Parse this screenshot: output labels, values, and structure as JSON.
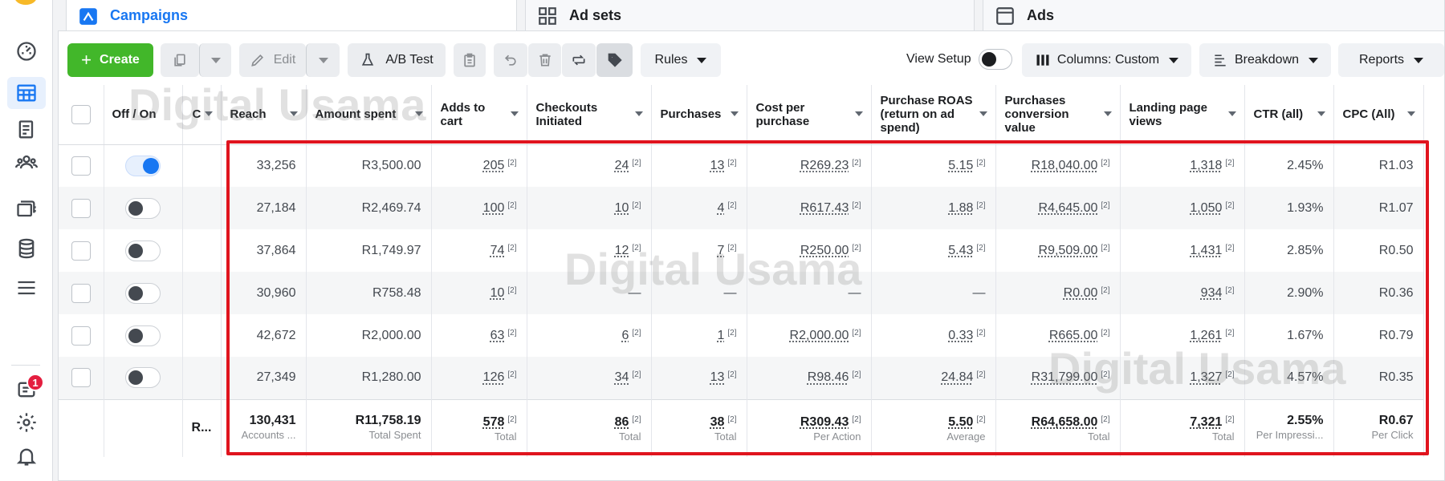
{
  "tabs": {
    "campaigns": "Campaigns",
    "adsets": "Ad sets",
    "ads": "Ads"
  },
  "toolbar": {
    "create": "Create",
    "edit": "Edit",
    "ab_test": "A/B Test",
    "rules": "Rules",
    "view_setup": "View Setup",
    "columns": "Columns: Custom",
    "breakdown": "Breakdown",
    "reports": "Reports"
  },
  "rail": {
    "notification_count": "1"
  },
  "table": {
    "headers": {
      "off_on": "Off / On",
      "name_truncated": "C",
      "reach": "Reach",
      "amount_spent": "Amount spent",
      "adds_to_cart": "Adds to cart",
      "checkouts": "Checkouts Initiated",
      "purchases": "Purchases",
      "cost_per_purchase": "Cost per purchase",
      "roas": "Purchase ROAS (return on ad spend)",
      "conv_value": "Purchases conversion value",
      "lpv": "Landing page views",
      "ctr": "CTR (all)",
      "cpc": "CPC (All)"
    },
    "rows": [
      {
        "on": true,
        "reach": "33,256",
        "spent": "R3,500.00",
        "atc": "205",
        "chk": "24",
        "pur": "13",
        "cpp": "R269.23",
        "roas": "5.15",
        "val": "R18,040.00",
        "lpv": "1,318",
        "ctr": "2.45%",
        "cpc": "R1.03"
      },
      {
        "on": false,
        "reach": "27,184",
        "spent": "R2,469.74",
        "atc": "100",
        "chk": "10",
        "pur": "4",
        "cpp": "R617.43",
        "roas": "1.88",
        "val": "R4,645.00",
        "lpv": "1,050",
        "ctr": "1.93%",
        "cpc": "R1.07"
      },
      {
        "on": false,
        "reach": "37,864",
        "spent": "R1,749.97",
        "atc": "74",
        "chk": "12",
        "pur": "7",
        "cpp": "R250.00",
        "roas": "5.43",
        "val": "R9,509.00",
        "lpv": "1,431",
        "ctr": "2.85%",
        "cpc": "R0.50"
      },
      {
        "on": false,
        "reach": "30,960",
        "spent": "R758.48",
        "atc": "10",
        "chk": "—",
        "pur": "—",
        "cpp": "—",
        "roas": "—",
        "val": "R0.00",
        "lpv": "934",
        "ctr": "2.90%",
        "cpc": "R0.36"
      },
      {
        "on": false,
        "reach": "42,672",
        "spent": "R2,000.00",
        "atc": "63",
        "chk": "6",
        "pur": "1",
        "cpp": "R2,000.00",
        "roas": "0.33",
        "val": "R665.00",
        "lpv": "1,261",
        "ctr": "1.67%",
        "cpc": "R0.79"
      },
      {
        "on": false,
        "reach": "27,349",
        "spent": "R1,280.00",
        "atc": "126",
        "chk": "34",
        "pur": "13",
        "cpp": "R98.46",
        "roas": "24.84",
        "val": "R31,799.00",
        "lpv": "1,327",
        "ctr": "4.57%",
        "cpc": "R0.35"
      }
    ],
    "footnote_mark": "[2]",
    "totals": {
      "name": "R...",
      "reach": {
        "v": "130,431",
        "l": "Accounts ..."
      },
      "spent": {
        "v": "R11,758.19",
        "l": "Total Spent"
      },
      "atc": {
        "v": "578",
        "l": "Total"
      },
      "chk": {
        "v": "86",
        "l": "Total"
      },
      "pur": {
        "v": "38",
        "l": "Total"
      },
      "cpp": {
        "v": "R309.43",
        "l": "Per Action"
      },
      "roas": {
        "v": "5.50",
        "l": "Average"
      },
      "val": {
        "v": "R64,658.00",
        "l": "Total"
      },
      "lpv": {
        "v": "7,321",
        "l": "Total"
      },
      "ctr": {
        "v": "2.55%",
        "l": "Per Impressi..."
      },
      "cpc": {
        "v": "R0.67",
        "l": "Per Click"
      }
    }
  },
  "watermark": "Digital Usama",
  "colors": {
    "accent": "#1877f2",
    "create": "#42b72a",
    "highlight": "#e0141e",
    "badge": "#e41e3f"
  }
}
